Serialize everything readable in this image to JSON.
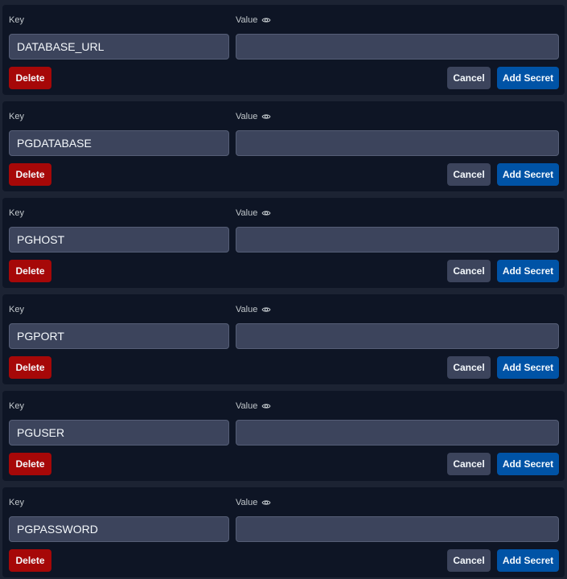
{
  "labels": {
    "key": "Key",
    "value": "Value"
  },
  "buttons": {
    "delete": "Delete",
    "cancel": "Cancel",
    "add": "Add Secret"
  },
  "icons": {
    "value_visibility": "eye-icon"
  },
  "colors": {
    "page_background": "#1c2333",
    "card_background": "#0e1525",
    "input_background": "#3c445c",
    "delete_button": "#a60808",
    "cancel_button": "#3c445c",
    "add_button": "#0053a6"
  },
  "secrets": [
    {
      "key": "DATABASE_URL",
      "value": ""
    },
    {
      "key": "PGDATABASE",
      "value": ""
    },
    {
      "key": "PGHOST",
      "value": ""
    },
    {
      "key": "PGPORT",
      "value": ""
    },
    {
      "key": "PGUSER",
      "value": ""
    },
    {
      "key": "PGPASSWORD",
      "value": ""
    }
  ]
}
